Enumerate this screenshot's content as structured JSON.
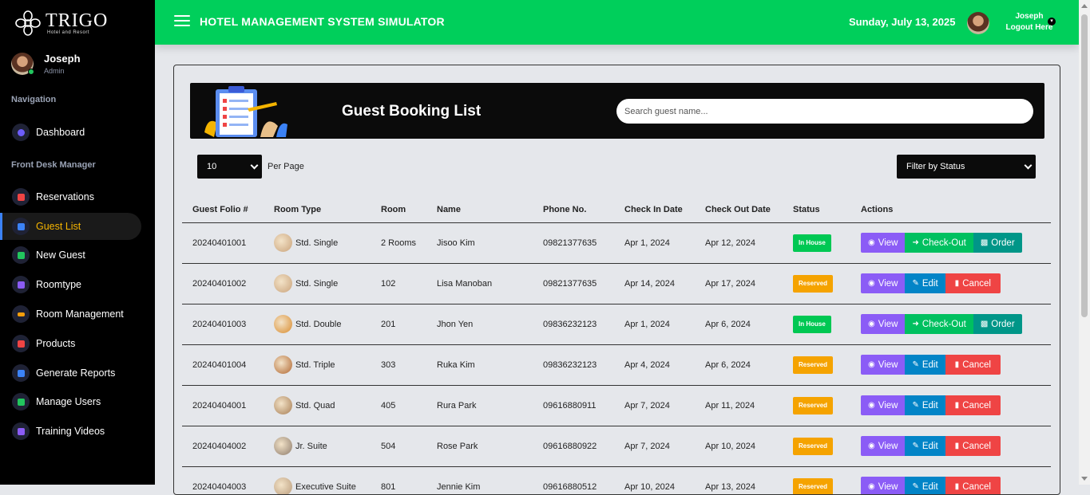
{
  "brand": {
    "name": "TRIGO",
    "tagline": "Hotel and Resort"
  },
  "user": {
    "name": "Joseph",
    "role": "Admin"
  },
  "sidebar": {
    "sections": [
      "Navigation",
      "Front Desk Manager"
    ],
    "items": [
      {
        "label": "Dashboard",
        "icon": "gauge-icon",
        "color": "#6d5dfc"
      },
      {
        "label": "Reservations",
        "icon": "calendar-icon",
        "color": "#ef4444"
      },
      {
        "label": "Guest List",
        "icon": "book-icon",
        "color": "#3b82f6",
        "active": true
      },
      {
        "label": "New Guest",
        "icon": "user-plus-icon",
        "color": "#22c55e"
      },
      {
        "label": "Roomtype",
        "icon": "list-icon",
        "color": "#8b5cf6"
      },
      {
        "label": "Room Management",
        "icon": "bed-icon",
        "color": "#f59e0b"
      },
      {
        "label": "Products",
        "icon": "chart-icon",
        "color": "#ef4444"
      },
      {
        "label": "Generate Reports",
        "icon": "print-icon",
        "color": "#3b82f6"
      },
      {
        "label": "Manage Users",
        "icon": "users-icon",
        "color": "#22c55e"
      },
      {
        "label": "Training Videos",
        "icon": "video-icon",
        "color": "#8b5cf6"
      }
    ]
  },
  "topbar": {
    "title": "HOTEL MANAGEMENT SYSTEM SIMULATOR",
    "date": "Sunday, July 13, 2025",
    "user_name": "Joseph",
    "logout_label": "Logout Here",
    "bg_color": "#00cf5b"
  },
  "main": {
    "heading": "Guest Booking List",
    "search_placeholder": "Search guest name...",
    "per_page_value": "10",
    "per_page_label": "Per Page",
    "filter_value": "Filter by Status"
  },
  "table": {
    "headers": [
      "Guest Folio #",
      "Room Type",
      "Room",
      "Name",
      "Phone No.",
      "Check In Date",
      "Check Out Date",
      "Status",
      "Actions"
    ],
    "rows": [
      {
        "folio": "20240401001",
        "room_type": "Std. Single",
        "room": "2 Rooms",
        "name": "Jisoo Kim",
        "phone": "09821377635",
        "check_in": "Apr 1, 2024",
        "check_out": "Apr 12, 2024",
        "status": "In House"
      },
      {
        "folio": "20240401002",
        "room_type": "Std. Single",
        "room": "102",
        "name": "Lisa Manoban",
        "phone": "09821377635",
        "check_in": "Apr 14, 2024",
        "check_out": "Apr 17, 2024",
        "status": "Reserved"
      },
      {
        "folio": "20240401003",
        "room_type": "Std. Double",
        "room": "201",
        "name": "Jhon Yen",
        "phone": "09836232123",
        "check_in": "Apr 1, 2024",
        "check_out": "Apr 6, 2024",
        "status": "In House"
      },
      {
        "folio": "20240401004",
        "room_type": "Std. Triple",
        "room": "303",
        "name": "Ruka Kim",
        "phone": "09836232123",
        "check_in": "Apr 4, 2024",
        "check_out": "Apr 6, 2024",
        "status": "Reserved"
      },
      {
        "folio": "20240404001",
        "room_type": "Std. Quad",
        "room": "405",
        "name": "Rura Park",
        "phone": "09616880911",
        "check_in": "Apr 7, 2024",
        "check_out": "Apr 11, 2024",
        "status": "Reserved"
      },
      {
        "folio": "20240404002",
        "room_type": "Jr. Suite",
        "room": "504",
        "name": "Rose Park",
        "phone": "09616880922",
        "check_in": "Apr 7, 2024",
        "check_out": "Apr 10, 2024",
        "status": "Reserved"
      },
      {
        "folio": "20240404003",
        "room_type": "Executive Suite",
        "room": "801",
        "name": "Jennie Kim",
        "phone": "09616880512",
        "check_in": "Apr 10, 2024",
        "check_out": "Apr 13, 2024",
        "status": "Reserved"
      }
    ],
    "status_colors": {
      "In House": "#00c853",
      "Reserved": "#f5a300"
    },
    "actions": {
      "view": "View",
      "checkout": "Check-Out",
      "order": "Order",
      "edit": "Edit",
      "cancel": "Cancel"
    }
  }
}
